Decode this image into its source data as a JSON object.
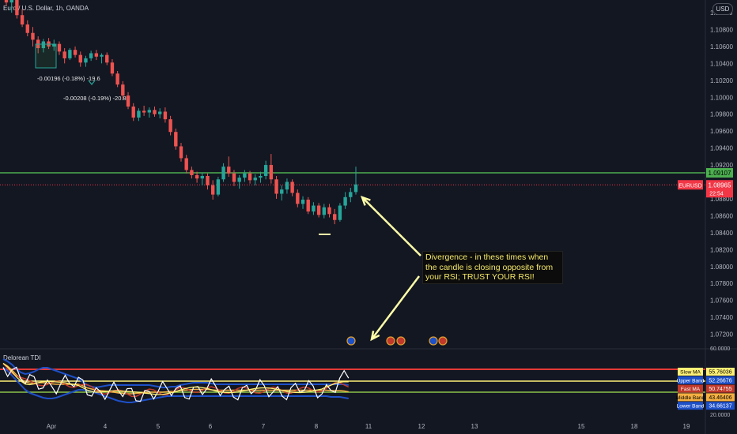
{
  "header": {
    "symbol_title": "Euro / U.S. Dollar, 1h, OANDA",
    "currency_button": "USD"
  },
  "colors": {
    "background": "#131722",
    "bull": "#26a69a",
    "bear": "#ef5350",
    "support_line": "#4caf50",
    "price_line": "#f23645",
    "annotation_text": "#f5e96a",
    "arrow": "#ffffa8"
  },
  "measurements": [
    {
      "label": "-0.00196 (-0.18%) -19.6"
    },
    {
      "label": "-0.00208 (-0.19%) -20.8"
    }
  ],
  "annotation": {
    "text": "Divergence - in these times when the candle is closing opposite from your RSI; TRUST YOUR RSI!"
  },
  "indicator": {
    "title": "Delorean TDI",
    "legend": [
      {
        "name": "Slow MA",
        "value": "55.76036",
        "color": "#fff176",
        "text": "#000000"
      },
      {
        "name": "Upper Band",
        "value": "52.26676",
        "color": "#1e50c8",
        "text": "#ffffff"
      },
      {
        "name": "Fast MA",
        "value": "50.74755",
        "color": "#c0392b",
        "text": "#ffffff"
      },
      {
        "name": "Middle Band",
        "value": "43.46406",
        "color": "#f5b041",
        "text": "#000000"
      },
      {
        "name": "Lower Band",
        "value": "34.66137",
        "color": "#1e50c8",
        "text": "#ffffff"
      }
    ],
    "axis_labels": [
      "60.0000",
      "20.0000"
    ]
  },
  "chart_data": {
    "type": "candlestick",
    "title": "Euro / U.S. Dollar, 1h, OANDA",
    "y_ticks": [
      "1.11000",
      "1.10800",
      "1.10600",
      "1.10400",
      "1.10200",
      "1.10000",
      "1.09800",
      "1.09600",
      "1.09400",
      "1.09200",
      "1.08800",
      "1.08600",
      "1.08400",
      "1.08200",
      "1.08000",
      "1.07800",
      "1.07600",
      "1.07400",
      "1.07200"
    ],
    "ylim": [
      1.071,
      1.114
    ],
    "x_ticks": [
      "Apr",
      "4",
      "5",
      "6",
      "7",
      "8",
      "11",
      "12",
      "13",
      "15",
      "18",
      "19"
    ],
    "horizontal_line": {
      "value": "1.09107"
    },
    "current_price": {
      "label": "EURUSD",
      "value": "1.08965",
      "countdown": "22:54"
    },
    "candles": [
      [
        1.1128,
        1.1136,
        1.1108,
        1.1112
      ],
      [
        1.1112,
        1.112,
        1.11,
        1.1116
      ],
      [
        1.1116,
        1.1119,
        1.1093,
        1.1097
      ],
      [
        1.1097,
        1.1104,
        1.1083,
        1.1086
      ],
      [
        1.1086,
        1.1091,
        1.1072,
        1.1076
      ],
      [
        1.1076,
        1.1083,
        1.106,
        1.1068
      ],
      [
        1.1068,
        1.1072,
        1.1052,
        1.1058
      ],
      [
        1.1058,
        1.1069,
        1.1053,
        1.1066
      ],
      [
        1.1066,
        1.107,
        1.1057,
        1.106
      ],
      [
        1.106,
        1.1068,
        1.1055,
        1.1063
      ],
      [
        1.1063,
        1.1066,
        1.105,
        1.1054
      ],
      [
        1.1054,
        1.1058,
        1.104,
        1.1046
      ],
      [
        1.1046,
        1.1058,
        1.1044,
        1.1056
      ],
      [
        1.1056,
        1.106,
        1.1047,
        1.105
      ],
      [
        1.105,
        1.1054,
        1.1036,
        1.1041
      ],
      [
        1.1041,
        1.1049,
        1.1036,
        1.1046
      ],
      [
        1.1046,
        1.1055,
        1.1043,
        1.1052
      ],
      [
        1.1052,
        1.1056,
        1.1044,
        1.1048
      ],
      [
        1.1048,
        1.1052,
        1.104,
        1.105
      ],
      [
        1.105,
        1.1053,
        1.1038,
        1.1041
      ],
      [
        1.1041,
        1.1045,
        1.1025,
        1.1028
      ],
      [
        1.1028,
        1.1031,
        1.1012,
        1.1015
      ],
      [
        1.1015,
        1.1019,
        1.0998,
        1.1002
      ],
      [
        1.1002,
        1.1006,
        1.0986,
        1.0989
      ],
      [
        1.0989,
        1.0993,
        1.0972,
        1.0976
      ],
      [
        1.0976,
        1.0987,
        1.0972,
        1.0984
      ],
      [
        1.0984,
        1.099,
        1.0978,
        1.0982
      ],
      [
        1.0982,
        1.0988,
        1.0976,
        1.0985
      ],
      [
        1.0985,
        1.0989,
        1.0977,
        1.098
      ],
      [
        1.098,
        1.0987,
        1.0975,
        1.0983
      ],
      [
        1.0983,
        1.0988,
        1.097,
        1.0974
      ],
      [
        1.0974,
        1.0978,
        1.0955,
        1.0959
      ],
      [
        1.0959,
        1.0963,
        1.0938,
        1.0942
      ],
      [
        1.0942,
        1.0946,
        1.0924,
        1.0928
      ],
      [
        1.0928,
        1.0932,
        1.091,
        1.0914
      ],
      [
        1.0914,
        1.0918,
        1.0904,
        1.0908
      ],
      [
        1.0908,
        1.0912,
        1.0899,
        1.0904
      ],
      [
        1.0904,
        1.0911,
        1.0896,
        1.0907
      ],
      [
        1.0907,
        1.091,
        1.0891,
        1.0896
      ],
      [
        1.0896,
        1.0902,
        1.0879,
        1.0885
      ],
      [
        1.0885,
        1.0906,
        1.0883,
        1.0903
      ],
      [
        1.0903,
        1.0922,
        1.09,
        1.0918
      ],
      [
        1.0918,
        1.093,
        1.0906,
        1.091
      ],
      [
        1.091,
        1.0914,
        1.0895,
        1.09
      ],
      [
        1.09,
        1.0908,
        1.0892,
        1.0905
      ],
      [
        1.0905,
        1.0914,
        1.09,
        1.091
      ],
      [
        1.091,
        1.0913,
        1.0898,
        1.0902
      ],
      [
        1.0902,
        1.0909,
        1.0896,
        1.0905
      ],
      [
        1.0905,
        1.0912,
        1.0899,
        1.0907
      ],
      [
        1.0907,
        1.0925,
        1.0903,
        1.092
      ],
      [
        1.092,
        1.0933,
        1.0898,
        1.0903
      ],
      [
        1.0903,
        1.0907,
        1.088,
        1.0886
      ],
      [
        1.0886,
        1.0896,
        1.0878,
        1.0891
      ],
      [
        1.0891,
        1.0904,
        1.0886,
        1.09
      ],
      [
        1.09,
        1.0903,
        1.0883,
        1.0887
      ],
      [
        1.0887,
        1.0891,
        1.087,
        1.0874
      ],
      [
        1.0874,
        1.0883,
        1.0868,
        1.0879
      ],
      [
        1.0879,
        1.0882,
        1.0862,
        1.0865
      ],
      [
        1.0865,
        1.0876,
        1.0861,
        1.0872
      ],
      [
        1.0872,
        1.0875,
        1.0858,
        1.0861
      ],
      [
        1.0861,
        1.0874,
        1.0857,
        1.087
      ],
      [
        1.087,
        1.0874,
        1.0858,
        1.0862
      ],
      [
        1.0862,
        1.0868,
        1.085,
        1.0855
      ],
      [
        1.0855,
        1.0875,
        1.0853,
        1.0872
      ],
      [
        1.0872,
        1.0888,
        1.0868,
        1.0882
      ],
      [
        1.0882,
        1.0893,
        1.0876,
        1.0888
      ],
      [
        1.0888,
        1.0918,
        1.0885,
        1.0897
      ]
    ]
  }
}
